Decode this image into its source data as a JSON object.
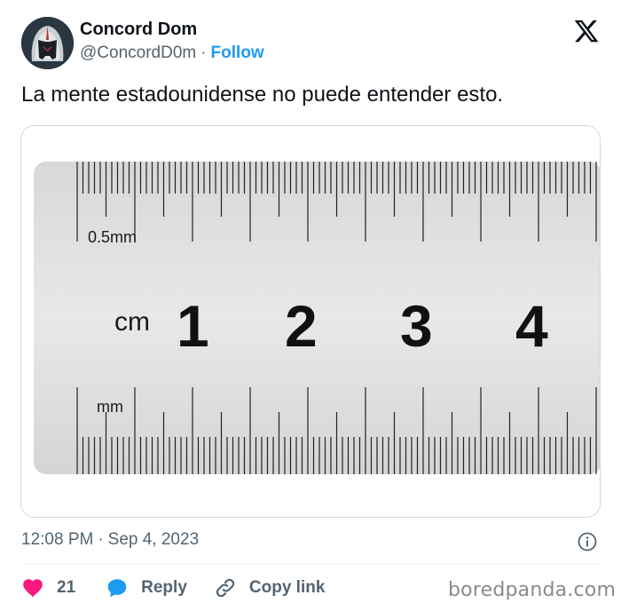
{
  "author": {
    "name": "Concord Dom",
    "handle": "@ConcordD0m",
    "separator": "·",
    "follow_label": "Follow"
  },
  "tweet": {
    "text": "La mente estadounidense no puede entender esto."
  },
  "image": {
    "label_half_mm": "0.5mm",
    "label_cm": "cm",
    "label_mm": "mm",
    "numbers": [
      "1",
      "2",
      "3",
      "4"
    ]
  },
  "meta": {
    "time": "12:08 PM",
    "separator": "·",
    "date": "Sep 4, 2023"
  },
  "actions": {
    "like_count": "21",
    "reply_label": "Reply",
    "copy_link_label": "Copy link"
  },
  "brand": {
    "watermark": "boredpanda.com"
  },
  "colors": {
    "accent": "#1d9bf0",
    "like": "#f91880",
    "text": "#0f1419",
    "secondary": "#536471"
  },
  "icons": {
    "platform": "x-logo-icon",
    "info": "info-icon",
    "like": "heart-icon",
    "reply": "reply-bubble-icon",
    "copy_link": "link-icon"
  }
}
